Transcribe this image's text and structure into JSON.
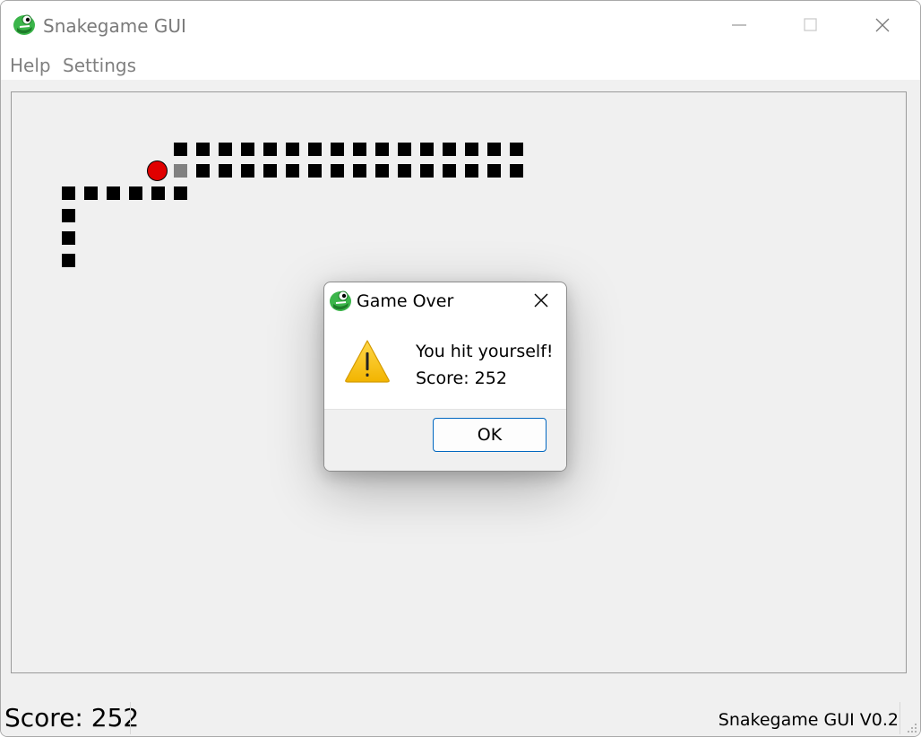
{
  "window": {
    "title": "Snakegame GUI",
    "app_icon": "green-snake-icon"
  },
  "menu": {
    "items": [
      {
        "label": "Help"
      },
      {
        "label": "Settings"
      }
    ]
  },
  "game": {
    "snake_segment_color": "#000000",
    "snake_head_color": "#808080",
    "food_color": "#e00000",
    "food_icon": "red-apple-dot"
  },
  "status": {
    "score": "Score: 252",
    "version": "Snakegame GUI V0.2"
  },
  "dialog": {
    "title": "Game Over",
    "icon": "warning-icon",
    "message": "You hit yourself!",
    "score": "Score: 252",
    "ok_label": "OK",
    "accent_color": "#0067c0"
  }
}
